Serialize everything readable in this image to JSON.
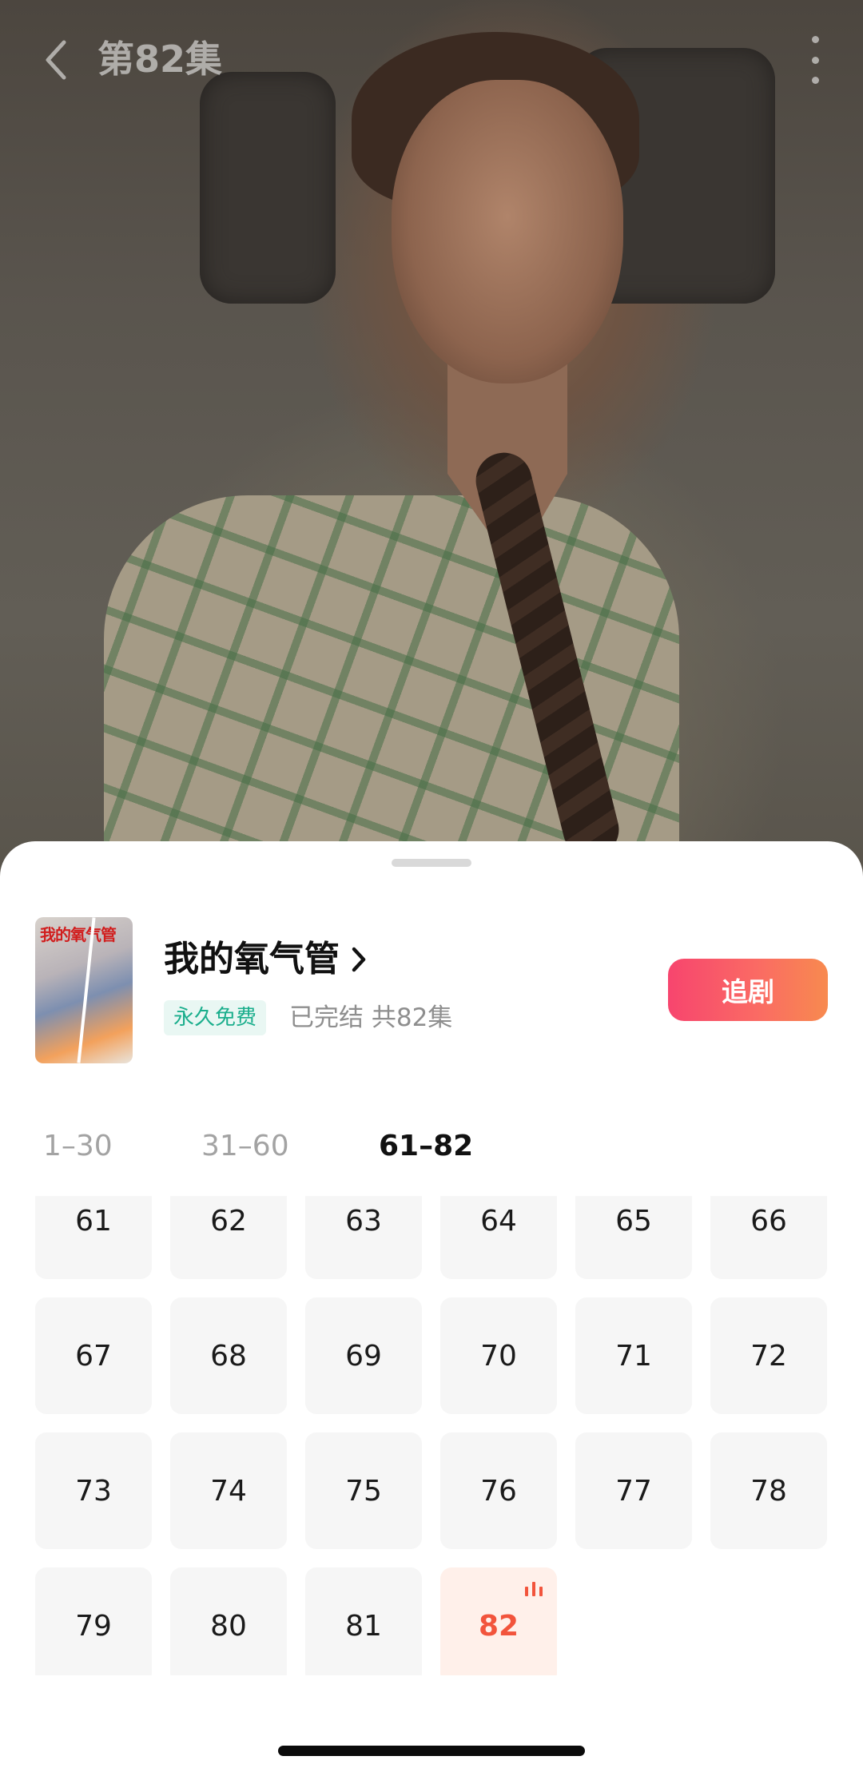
{
  "video": {
    "episode_title": "第82集"
  },
  "show": {
    "cover_title": "我的氧气管",
    "title": "我的氧气管",
    "free_tag": "永久免费",
    "meta": "已完结 共82集",
    "follow_label": "追剧"
  },
  "tabs": [
    {
      "label": "1–30",
      "selected": false
    },
    {
      "label": "31–60",
      "selected": false
    },
    {
      "label": "61–82",
      "selected": true
    }
  ],
  "episodes": [
    "61",
    "62",
    "63",
    "64",
    "65",
    "66",
    "67",
    "68",
    "69",
    "70",
    "71",
    "72",
    "73",
    "74",
    "75",
    "76",
    "77",
    "78",
    "79",
    "80",
    "81",
    "82"
  ],
  "current_episode": "82",
  "colors": {
    "accent": "#f2543c",
    "follow_gradient_start": "#f7456e",
    "follow_gradient_end": "#f88a4f",
    "free_tag_text": "#1aae8c"
  }
}
